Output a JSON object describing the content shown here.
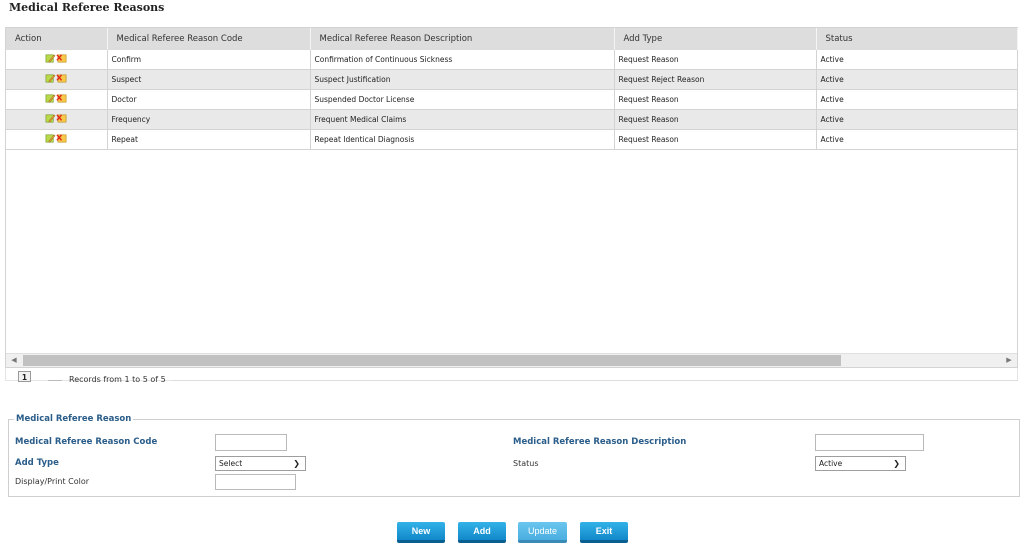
{
  "page": {
    "title": "Medical Referee Reasons"
  },
  "grid": {
    "columns": [
      "Action",
      "Medical Referee Reason Code",
      "Medical Referee Reason Description",
      "Add Type",
      "Status"
    ],
    "rows": [
      {
        "code": "Confirm",
        "description": "Confirmation of Continuous Sickness",
        "add_type": "Request Reason",
        "status": "Active"
      },
      {
        "code": "Suspect",
        "description": "Suspect Justification",
        "add_type": "Request Reject Reason",
        "status": "Active"
      },
      {
        "code": "Doctor",
        "description": "Suspended Doctor License",
        "add_type": "Request Reason",
        "status": "Active"
      },
      {
        "code": "Frequency",
        "description": "Frequent Medical Claims",
        "add_type": "Request Reason",
        "status": "Active"
      },
      {
        "code": "Repeat",
        "description": "Repeat Identical Diagnosis",
        "add_type": "Request Reason",
        "status": "Active"
      }
    ],
    "action_icons": [
      "edit-icon",
      "delete-icon"
    ]
  },
  "pager": {
    "current_page": "1",
    "records_text": "Records from 1 to 5 of 5"
  },
  "form": {
    "legend": "Medical Referee Reason",
    "code_label": "Medical Referee Reason Code",
    "code_value": "",
    "description_label": "Medical Referee Reason Description",
    "description_value": "",
    "add_type_label": "Add Type",
    "add_type_selected": "Select",
    "status_label": "Status",
    "status_selected": "Active",
    "color_label": "Display/Print Color",
    "color_value": ""
  },
  "buttons": {
    "new": "New",
    "add": "Add",
    "update": "Update",
    "exit": "Exit"
  },
  "colors": {
    "button": "#1a97d6",
    "label": "#2a5d8a",
    "header_bg": "#dddddd",
    "row_alt": "#e9e9e9"
  }
}
